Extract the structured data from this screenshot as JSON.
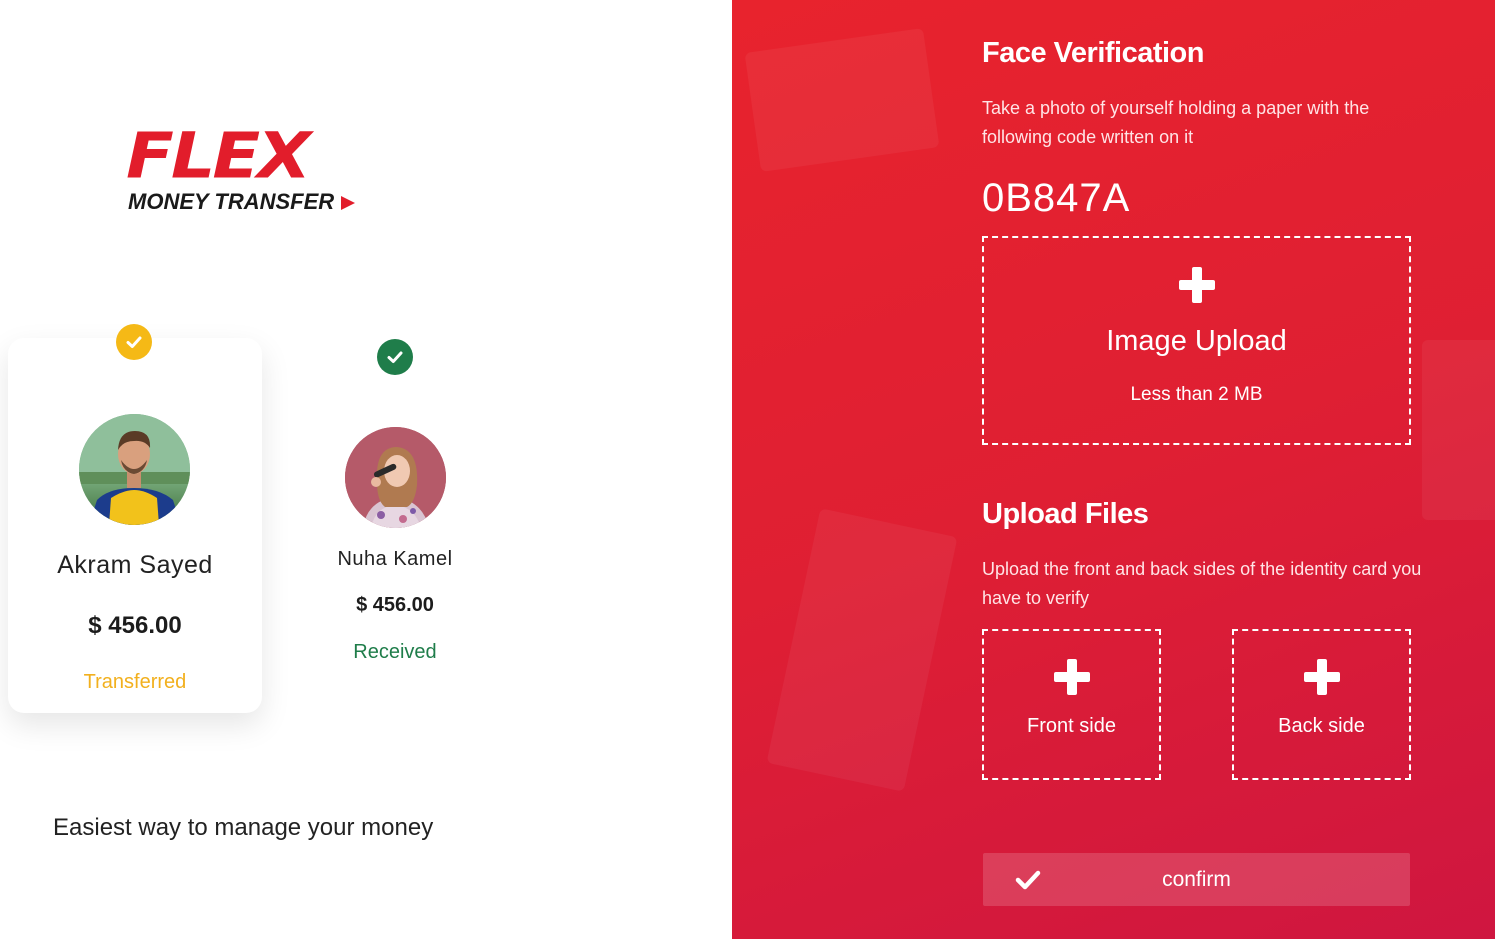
{
  "brand": {
    "logo_main": "FLEX",
    "logo_sub": "MONEY TRANSFER",
    "tagline": "Easiest way to manage your money",
    "accent_color": "#e21d2b"
  },
  "profiles": [
    {
      "name": "Akram Sayed",
      "amount": "$ 456.00",
      "status": "Transferred",
      "status_color": "#f2b01e",
      "check_icon": "check-circle-icon"
    },
    {
      "name": "Nuha Kamel",
      "amount": "$ 456.00",
      "status": "Received",
      "status_color": "#1f7d4a",
      "check_icon": "check-circle-icon"
    }
  ],
  "face_verification": {
    "title": "Face Verification",
    "description": "Take a photo of yourself holding a paper with the following code written on it",
    "code": "0B847A",
    "upload_title": "Image Upload",
    "upload_limit": "Less than 2 MB",
    "upload_icon": "plus-icon"
  },
  "upload_files": {
    "title": "Upload Files",
    "description": "Upload the front and back sides of the identity card you have to verify",
    "front_label": "Front side",
    "back_label": "Back side",
    "upload_icon": "plus-icon"
  },
  "confirm": {
    "label": "confirm",
    "icon": "check-icon"
  },
  "colors": {
    "panel_red": "#e21f30",
    "transferred": "#f2b01e",
    "received": "#1f7d4a"
  }
}
